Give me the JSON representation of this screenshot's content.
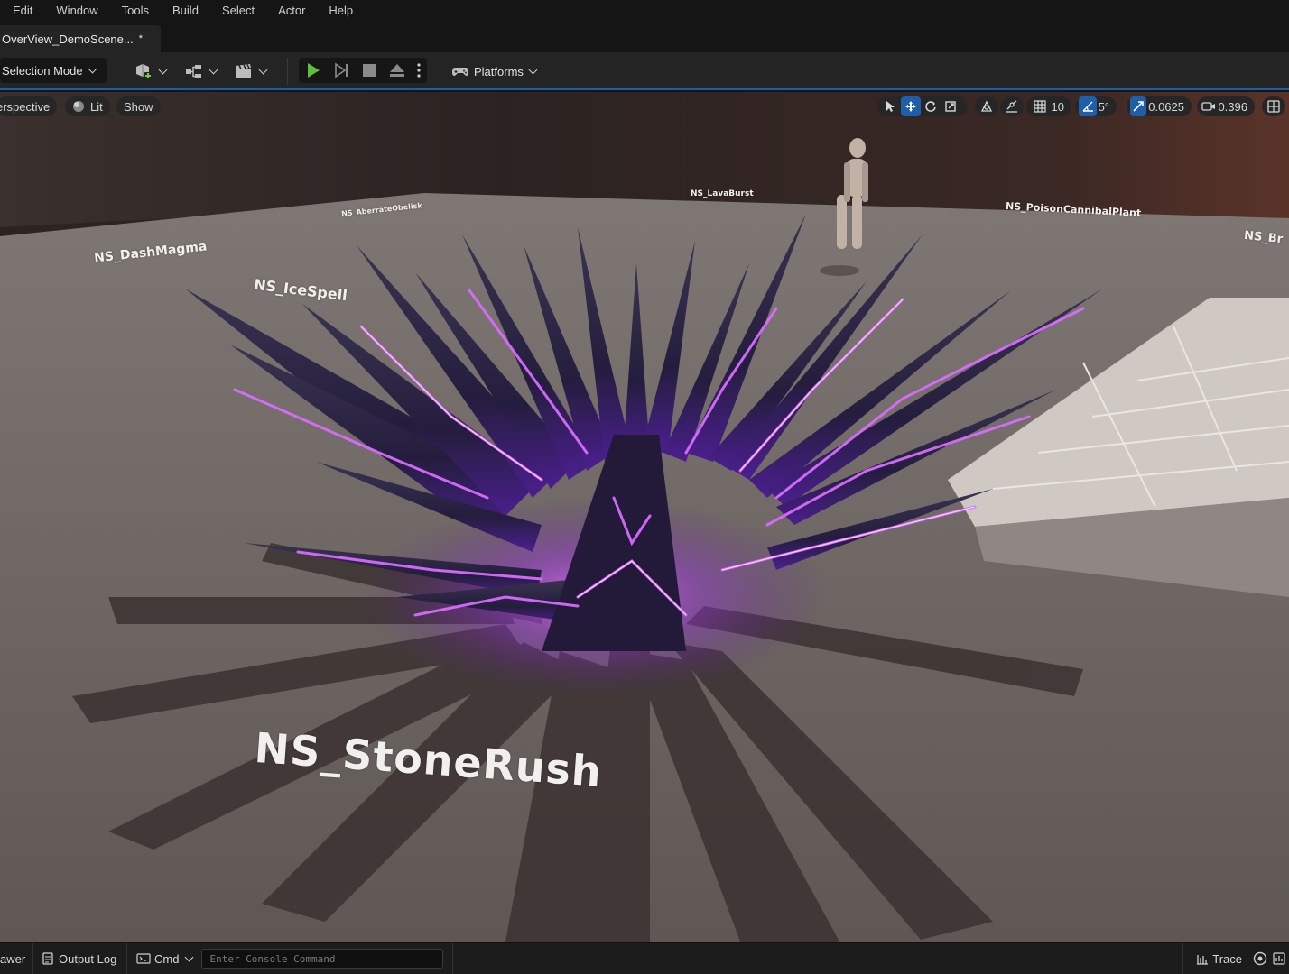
{
  "menubar": {
    "items": [
      "Edit",
      "Window",
      "Tools",
      "Build",
      "Select",
      "Actor",
      "Help"
    ]
  },
  "tab": {
    "title": "OverView_DemoScene...",
    "dirty_marker": "*"
  },
  "toolbar": {
    "selection_mode": "Selection Mode",
    "platforms": "Platforms"
  },
  "viewport": {
    "perspective": "erspective",
    "lit": "Lit",
    "show": "Show",
    "grid_snap": "10",
    "rotation_snap": "5°",
    "scale_snap": "0.0625",
    "camera_speed": "0.396"
  },
  "scene_labels": {
    "stone_rush": "NS_StoneRush",
    "dash_magma": "NS_DashMagma",
    "ice_spell": "NS_IceSpell",
    "aberrate_obelisk": "NS_AberrateObelisk",
    "lava_burst": "NS_LavaBurst",
    "poison_cannibal_plant": "NS_PoisonCannibalPlant",
    "partial_right": "NS_Br"
  },
  "statusbar": {
    "drawer": "awer",
    "output_log": "Output Log",
    "cmd": "Cmd",
    "console_placeholder": "Enter Console Command",
    "trace": "Trace"
  },
  "colors": {
    "accent": "#1f5ea8",
    "play_green": "#5fbf3a",
    "crystal_glow": "#c040ff"
  }
}
